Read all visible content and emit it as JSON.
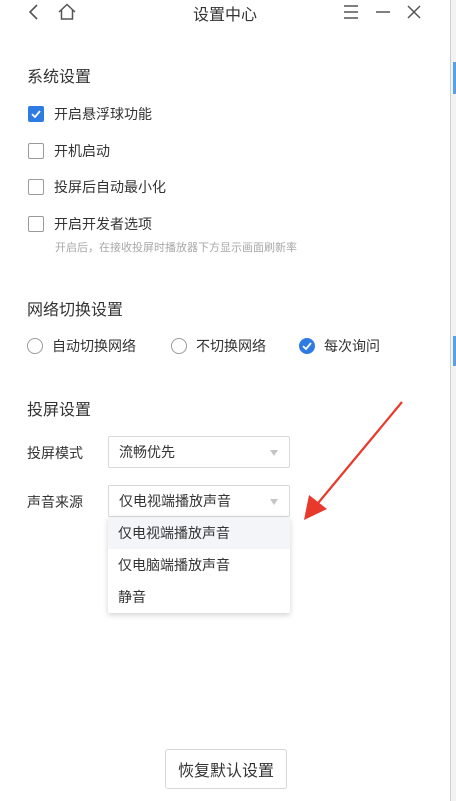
{
  "window": {
    "title": "设置中心"
  },
  "titlebar_icons": [
    "back-icon",
    "home-icon",
    "menu-icon",
    "minimize-icon",
    "close-icon"
  ],
  "system": {
    "title": "系统设置",
    "options": [
      {
        "label": "开启悬浮球功能",
        "checked": true
      },
      {
        "label": "开机启动",
        "checked": false
      },
      {
        "label": "投屏后自动最小化",
        "checked": false
      },
      {
        "label": "开启开发者选项",
        "checked": false
      }
    ],
    "dev_hint": "开启后，在接收投屏时播放器下方显示画面刷新率"
  },
  "network": {
    "title": "网络切换设置",
    "options": [
      {
        "label": "自动切换网络",
        "checked": false
      },
      {
        "label": "不切换网络",
        "checked": false
      },
      {
        "label": "每次询问",
        "checked": true
      }
    ]
  },
  "cast": {
    "title": "投屏设置",
    "mode_label": "投屏模式",
    "mode_value": "流畅优先",
    "sound_label": "声音来源",
    "sound_value": "仅电视端播放声音",
    "sound_options": [
      "仅电视端播放声音",
      "仅电脑端播放声音",
      "静音"
    ]
  },
  "reset_label": "恢复默认设置",
  "colors": {
    "accent": "#2f7be4",
    "annotation_arrow": "#e8392d"
  }
}
